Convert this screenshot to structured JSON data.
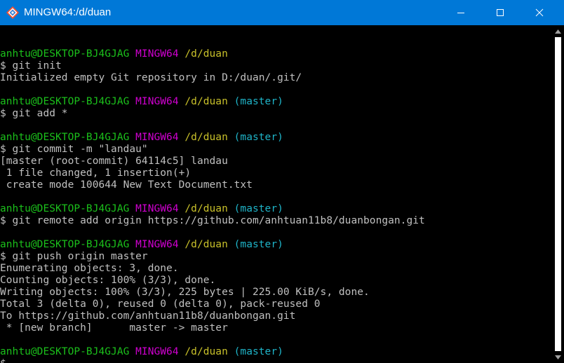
{
  "window": {
    "title": "MINGW64:/d/duan",
    "icon": "git-bash-icon",
    "controls": [
      "minimize-icon",
      "maximize-icon",
      "close-icon"
    ]
  },
  "colors": {
    "titlebar": "#0078d7",
    "user_host": "#1bc01b",
    "system": "#d000d0",
    "path": "#c8c02a",
    "branch": "#1fb4c8",
    "text": "#c0c0c0",
    "background": "#000000"
  },
  "terminal": {
    "user": "anhtu@DESKTOP-BJ4GJAG",
    "system": "MINGW64",
    "path": "/d/duan",
    "branch": "(master)",
    "blocks": [
      {
        "show_branch": false,
        "command": "$ git init",
        "output": [
          "Initialized empty Git repository in D:/duan/.git/"
        ]
      },
      {
        "show_branch": true,
        "command": "$ git add *",
        "output": []
      },
      {
        "show_branch": true,
        "command": "$ git commit -m \"landau\"",
        "output": [
          "[master (root-commit) 64114c5] landau",
          " 1 file changed, 1 insertion(+)",
          " create mode 100644 New Text Document.txt"
        ]
      },
      {
        "show_branch": true,
        "command": "$ git remote add origin https://github.com/anhtuan11b8/duanbongan.git",
        "output": []
      },
      {
        "show_branch": true,
        "command": "$ git push origin master",
        "output": [
          "Enumerating objects: 3, done.",
          "Counting objects: 100% (3/3), done.",
          "Writing objects: 100% (3/3), 225 bytes | 225.00 KiB/s, done.",
          "Total 3 (delta 0), reused 0 (delta 0), pack-reused 0",
          "To https://github.com/anhtuan11b8/duanbongan.git",
          " * [new branch]      master -> master"
        ]
      },
      {
        "show_branch": true,
        "command": "$",
        "output": []
      }
    ]
  }
}
